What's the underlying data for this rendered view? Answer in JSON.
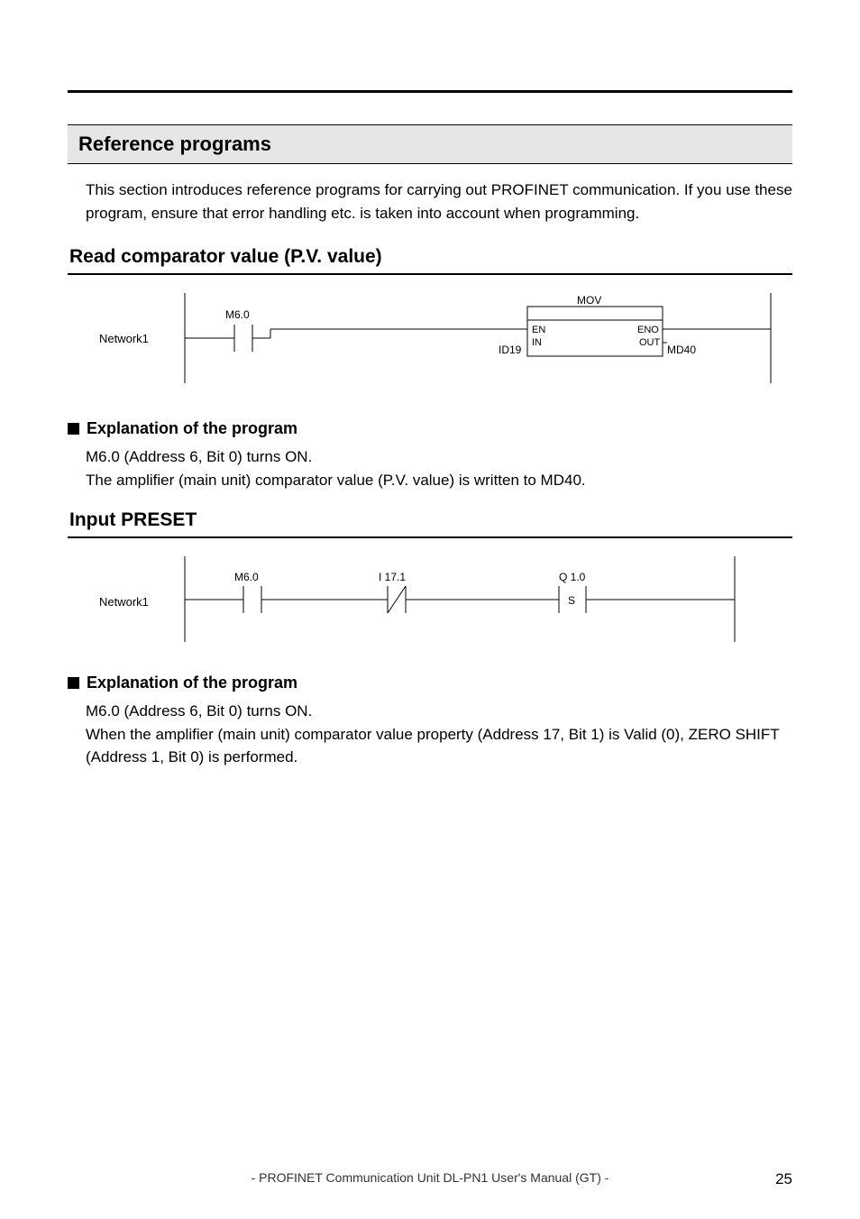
{
  "headings": {
    "h1": "Reference programs",
    "intro": "This section introduces reference programs for carrying out PROFINET communication. If you use these program, ensure that error handling etc. is taken into account when programming.",
    "h2_a": "Read comparator value (P.V. value)",
    "h3": "Explanation of the program",
    "exp1_l1": "M6.0 (Address 6, Bit 0) turns ON.",
    "exp1_l2": "The amplifier (main unit) comparator value (P.V. value) is written to MD40.",
    "h2_b": "Input PRESET",
    "exp2_l1": "M6.0 (Address 6, Bit 0) turns ON.",
    "exp2_l2": "When the amplifier (main unit) comparator value property (Address 17, Bit 1) is Valid (0), ZERO SHIFT (Address 1, Bit 0) is performed."
  },
  "diagram1": {
    "network": "Network1",
    "contact": "M6.0",
    "block_title": "MOV",
    "en": "EN",
    "eno": "ENO",
    "in": "IN",
    "out": "OUT",
    "in_val": "ID19",
    "out_val": "MD40"
  },
  "diagram2": {
    "network": "Network1",
    "contact": "M6.0",
    "nc": "I 17.1",
    "coil": "Q 1.0",
    "coil_type": "S"
  },
  "footer": "- PROFINET Communication Unit DL-PN1 User's Manual (GT) -",
  "page": "25"
}
